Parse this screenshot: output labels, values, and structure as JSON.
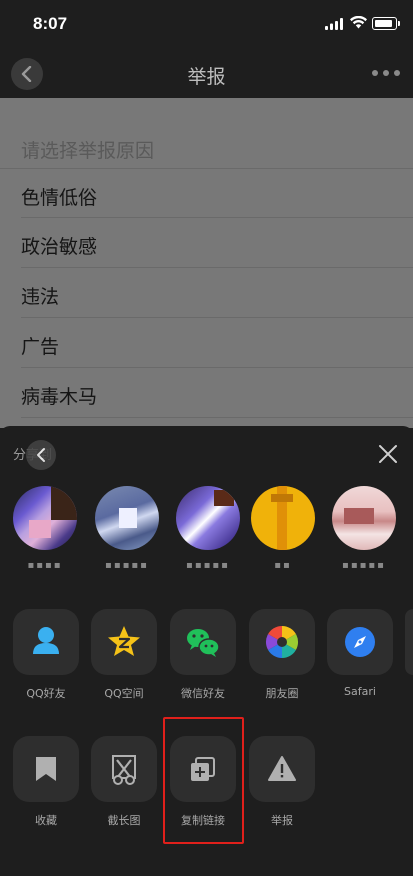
{
  "status_bar": {
    "time": "8:07"
  },
  "nav": {
    "title": "举报"
  },
  "report": {
    "hint": "请选择举报原因",
    "reasons": [
      "色情低俗",
      "政治敏感",
      "违法",
      "广告",
      "病毒木马"
    ]
  },
  "share_sheet": {
    "title": "分享到",
    "contacts": [
      {
        "name": "▪▪▪▪"
      },
      {
        "name": "▪▪▪▪▪"
      },
      {
        "name": "▪▪▪▪▪"
      },
      {
        "name": "▪▪"
      },
      {
        "name": "▪▪▪▪▪"
      }
    ],
    "share_targets": [
      {
        "label": "QQ好友",
        "icon": "qq-friend-icon"
      },
      {
        "label": "QQ空间",
        "icon": "qzone-icon"
      },
      {
        "label": "微信好友",
        "icon": "wechat-icon"
      },
      {
        "label": "朋友圈",
        "icon": "moments-icon"
      },
      {
        "label": "Safari",
        "icon": "safari-compass-icon"
      }
    ],
    "actions": [
      {
        "label": "收藏",
        "icon": "bookmark-icon"
      },
      {
        "label": "截长图",
        "icon": "scissors-icon"
      },
      {
        "label": "复制链接",
        "icon": "copy-link-icon"
      },
      {
        "label": "举报",
        "icon": "warning-icon"
      }
    ],
    "highlight_color": "#e0201b"
  }
}
